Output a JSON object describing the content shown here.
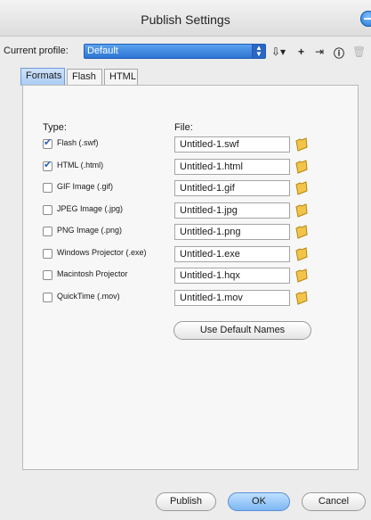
{
  "window": {
    "title": "Publish Settings"
  },
  "profile": {
    "label": "Current profile:",
    "value": "Default",
    "tools": [
      "import-export-icon",
      "plus-icon",
      "duplicate-icon",
      "info-icon",
      "trash-icon"
    ]
  },
  "tabs": [
    {
      "label": "Formats",
      "active": true
    },
    {
      "label": "Flash",
      "active": false
    },
    {
      "label": "HTML",
      "active": false
    }
  ],
  "formats": {
    "type_header": "Type:",
    "file_header": "File:",
    "rows": [
      {
        "label": "Flash (.swf)",
        "checked": true,
        "file": "Untitled-1.swf"
      },
      {
        "label": "HTML (.html)",
        "checked": true,
        "file": "Untitled-1.html"
      },
      {
        "label": "GIF Image (.gif)",
        "checked": false,
        "file": "Untitled-1.gif"
      },
      {
        "label": "JPEG Image (.jpg)",
        "checked": false,
        "file": "Untitled-1.jpg"
      },
      {
        "label": "PNG Image (.png)",
        "checked": false,
        "file": "Untitled-1.png"
      },
      {
        "label": "Windows Projector (.exe)",
        "checked": false,
        "file": "Untitled-1.exe"
      },
      {
        "label": "Macintosh Projector",
        "checked": false,
        "file": "Untitled-1.hqx"
      },
      {
        "label": "QuickTime (.mov)",
        "checked": false,
        "file": "Untitled-1.mov"
      }
    ],
    "use_default_names": "Use Default Names"
  },
  "footer": {
    "publish": "Publish",
    "ok": "OK",
    "cancel": "Cancel"
  }
}
